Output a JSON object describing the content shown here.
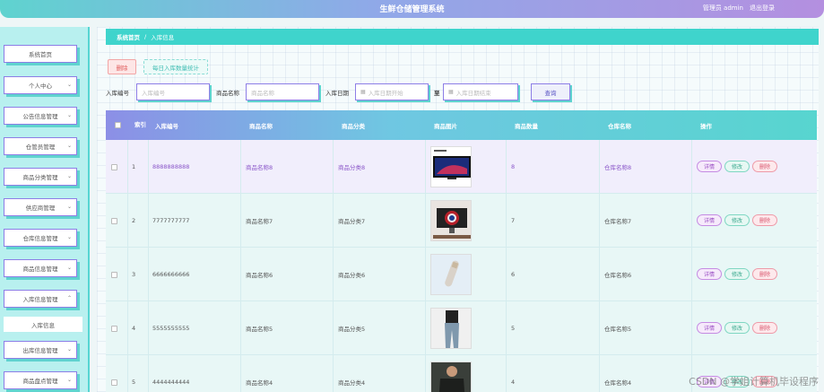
{
  "header": {
    "title": "生鲜仓储管理系统",
    "user": "管理员 admin",
    "logout": "退出登录"
  },
  "sidebar": {
    "items": [
      {
        "label": "系统首页",
        "chevron": ""
      },
      {
        "label": "个人中心",
        "chevron": "⌄"
      },
      {
        "label": "公告信息管理",
        "chevron": "⌄"
      },
      {
        "label": "仓管员管理",
        "chevron": "⌄"
      },
      {
        "label": "商品分类管理",
        "chevron": "⌄"
      },
      {
        "label": "供应商管理",
        "chevron": "⌄"
      },
      {
        "label": "仓库信息管理",
        "chevron": "⌄"
      },
      {
        "label": "商品信息管理",
        "chevron": "⌄"
      },
      {
        "label": "入库信息管理",
        "chevron": "⌃"
      },
      {
        "label": "出库信息管理",
        "chevron": "⌄"
      },
      {
        "label": "商品盘点管理",
        "chevron": "⌄"
      }
    ],
    "sub_item": "入库信息"
  },
  "breadcrumb": {
    "home": "系统首页",
    "sep": "/",
    "current": "入库信息"
  },
  "toolbar": {
    "delete_label": "删除",
    "stat_label": "每日入库数量统计"
  },
  "search": {
    "code_label": "入库编号",
    "code_placeholder": "入库编号",
    "name_label": "商品名称",
    "name_placeholder": "商品名称",
    "date_label": "入库日期",
    "date_start_placeholder": "入库日期开始",
    "to_label": "至",
    "date_end_placeholder": "入库日期结束",
    "query_label": "查询"
  },
  "table": {
    "headers": [
      "",
      "索引",
      "入库编号",
      "商品名称",
      "商品分类",
      "商品图片",
      "商品数量",
      "仓库名称",
      "操作"
    ],
    "actions": {
      "detail": "详情",
      "edit": "修改",
      "delete": "删除"
    },
    "rows": [
      {
        "index": "1",
        "code": "8888888888",
        "name": "商品名称8",
        "category": "商品分类8",
        "qty": "8",
        "warehouse": "仓库名称8",
        "image": "tv-icon"
      },
      {
        "index": "2",
        "code": "7777777777",
        "name": "商品名称7",
        "category": "商品分类7",
        "qty": "7",
        "warehouse": "仓库名称7",
        "image": "monitor-icon"
      },
      {
        "index": "3",
        "code": "6666666666",
        "name": "商品名称6",
        "category": "商品分类6",
        "qty": "6",
        "warehouse": "仓库名称6",
        "image": "device-icon"
      },
      {
        "index": "4",
        "code": "5555555555",
        "name": "商品名称5",
        "category": "商品分类5",
        "qty": "5",
        "warehouse": "仓库名称5",
        "image": "jeans-icon"
      },
      {
        "index": "5",
        "code": "4444444444",
        "name": "商品名称4",
        "category": "商品分类4",
        "qty": "4",
        "warehouse": "仓库名称4",
        "image": "shirt-icon"
      }
    ]
  },
  "watermark": "CSDN @学姐计算机毕设程序"
}
